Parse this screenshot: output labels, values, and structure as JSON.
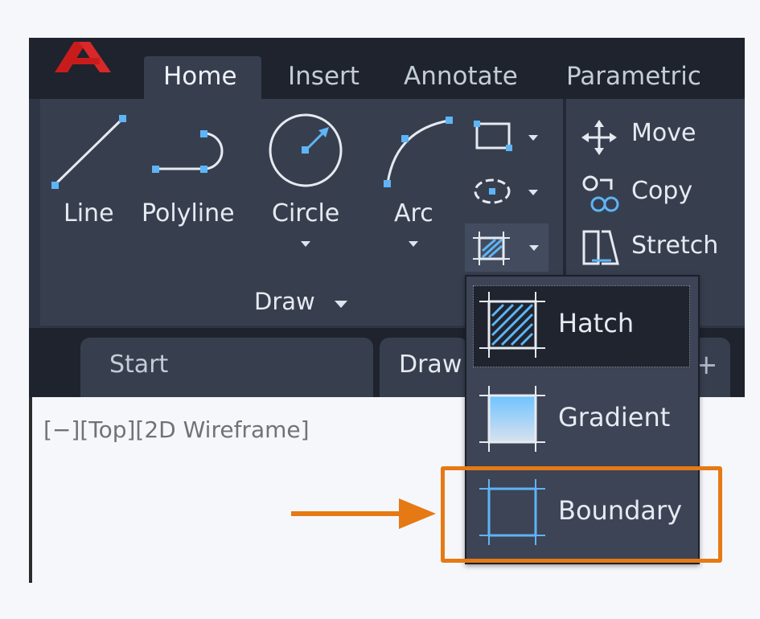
{
  "ribbon_tabs": [
    "Home",
    "Insert",
    "Annotate",
    "Parametric"
  ],
  "draw_tools": {
    "line": "Line",
    "polyline": "Polyline",
    "circle": "Circle",
    "arc": "Arc"
  },
  "draw_panel_title": "Draw",
  "modify_tools": {
    "move": "Move",
    "copy": "Copy",
    "stretch": "Stretch"
  },
  "doc_tabs": {
    "start": "Start",
    "drawing": "Draw",
    "new_tab": "+"
  },
  "viewport_label": "[−][Top][2D Wireframe]",
  "hatch_menu": {
    "hatch": "Hatch",
    "gradient": "Gradient",
    "boundary": "Boundary"
  },
  "colors": {
    "accent_blue": "#5eb4f5",
    "highlight_orange": "#e57a15",
    "logo_red": "#c81c1c"
  }
}
